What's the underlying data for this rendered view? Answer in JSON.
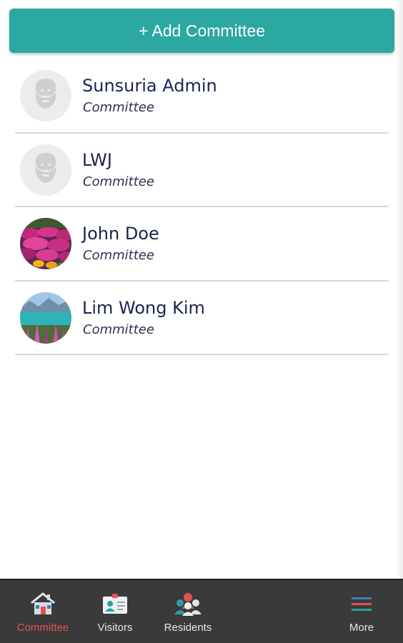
{
  "add_button": {
    "label": "+ Add Committee"
  },
  "committee_list": [
    {
      "name": "Sunsuria Admin",
      "role": "Committee",
      "avatar": "default-person-icon"
    },
    {
      "name": "LWJ",
      "role": "Committee",
      "avatar": "default-person-icon"
    },
    {
      "name": "John Doe",
      "role": "Committee",
      "avatar": "flowers-photo"
    },
    {
      "name": "Lim Wong Kim",
      "role": "Committee",
      "avatar": "lake-lupines-photo"
    }
  ],
  "tab_bar": {
    "items": [
      {
        "label": "Committee",
        "icon": "house-icon",
        "active": true
      },
      {
        "label": "Visitors",
        "icon": "visitor-card-icon",
        "active": false
      },
      {
        "label": "Residents",
        "icon": "residents-group-icon",
        "active": false
      },
      {
        "label": "More",
        "icon": "menu-lines-icon",
        "active": false
      }
    ]
  },
  "colors": {
    "accent": "#2aa8a1",
    "active_tab": "#e2534b",
    "tab_bar_bg": "#3a3a3a",
    "name_text": "#1c2350"
  }
}
